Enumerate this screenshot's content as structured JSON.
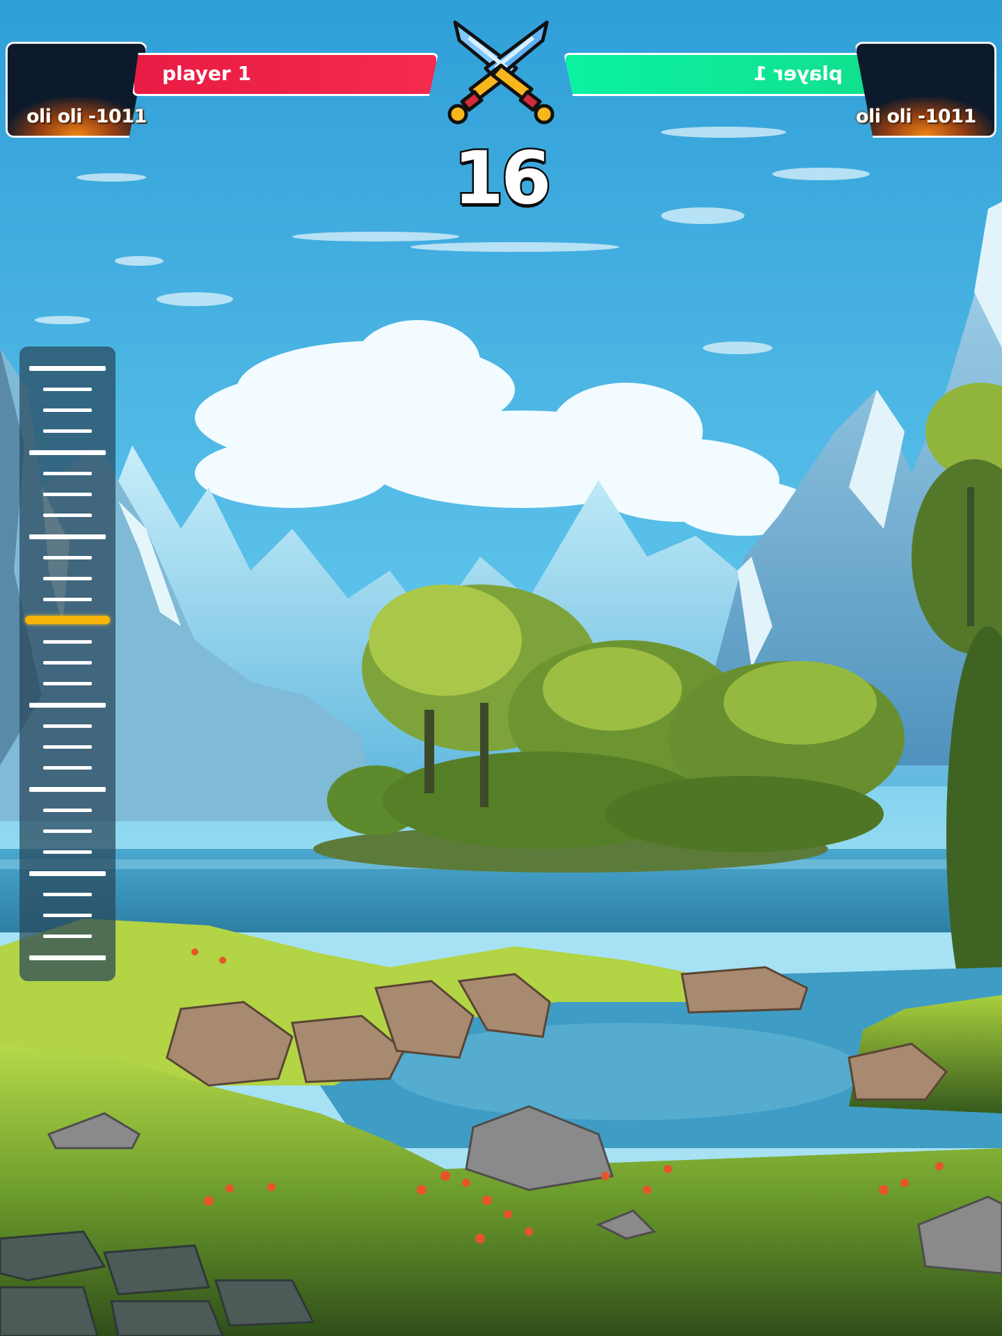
{
  "player_left": {
    "name_bar_label": "player 1",
    "avatar_caption": "oli oli -1011",
    "bar_color": "#e81c44"
  },
  "player_right": {
    "name_bar_label": "player 1",
    "avatar_caption": "oli oli -1011",
    "bar_color": "#11e08e"
  },
  "center": {
    "icon": "crossed-swords-icon",
    "score": "16"
  },
  "power_meter": {
    "indicator_color": "#f7b408",
    "level": 0.58
  }
}
